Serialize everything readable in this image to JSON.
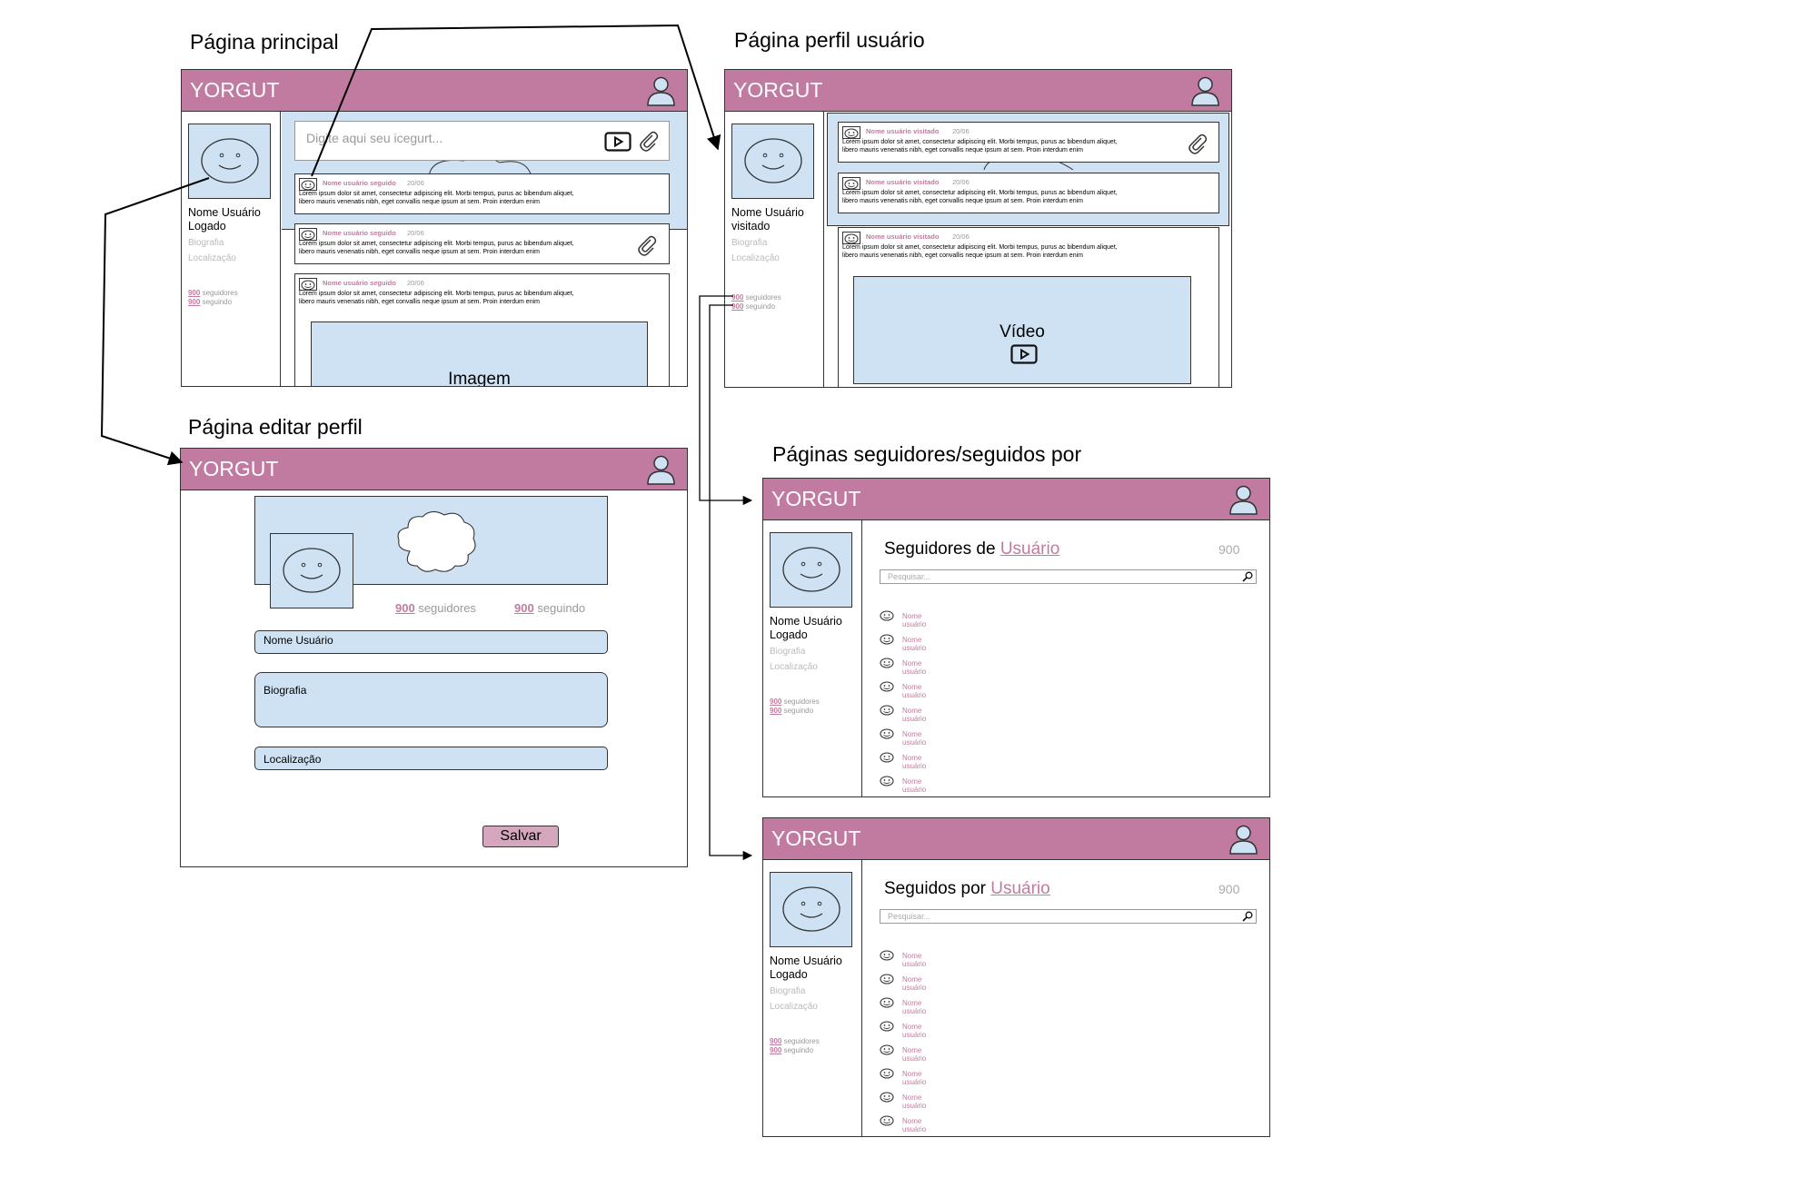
{
  "brand": "YORGUT",
  "colors": {
    "header": "#c27ba0",
    "panel": "#cfe2f3",
    "accent": "#c27ba0",
    "button": "#d5a6bd"
  },
  "titles": {
    "main": "Página principal",
    "profile": "Página perfil usuário",
    "edit": "Página editar perfil",
    "followers": "Páginas seguidores/seguidos por"
  },
  "sidebar": {
    "logged_name": "Nome Usuário Logado",
    "visited_name": "Nome Usuário visitado",
    "bio": "Biografia",
    "location": "Localização",
    "count": "900",
    "followers_word": "seguidores",
    "following_word": "seguindo"
  },
  "main": {
    "composer_placeholder": "Digite aqui seu icegurt...",
    "post_name": "Nome usuário seguido",
    "date": "20/06",
    "lorem_1": "Lorem ipsum dolor sit amet, consectetur adipiscing elit. Morbi tempus, purus ac bibendum aliquet,",
    "lorem_2": "libero mauris venenatis nibh, eget convallis neque ipsum at sem. Proin interdum enim",
    "image_label": "Imagem"
  },
  "profile": {
    "post_name": "Nome usuário visitado",
    "video_label": "Vídeo"
  },
  "edit": {
    "count": "900",
    "followers_word": "seguidores",
    "following_word": "seguindo",
    "name_field": "Nome Usuário",
    "bio_field": "Biografia",
    "location_field": "Localização",
    "save": "Salvar"
  },
  "followers_page": {
    "title_prefix": "Seguidores de",
    "user_link": "Usuário",
    "count": "900",
    "search_placeholder": "Pesquisar..."
  },
  "following_page": {
    "title_prefix": "Seguidos por",
    "user_link": "Usuário",
    "count": "900",
    "search_placeholder": "Pesquisar..."
  },
  "list_item_name": "Nome usuário"
}
